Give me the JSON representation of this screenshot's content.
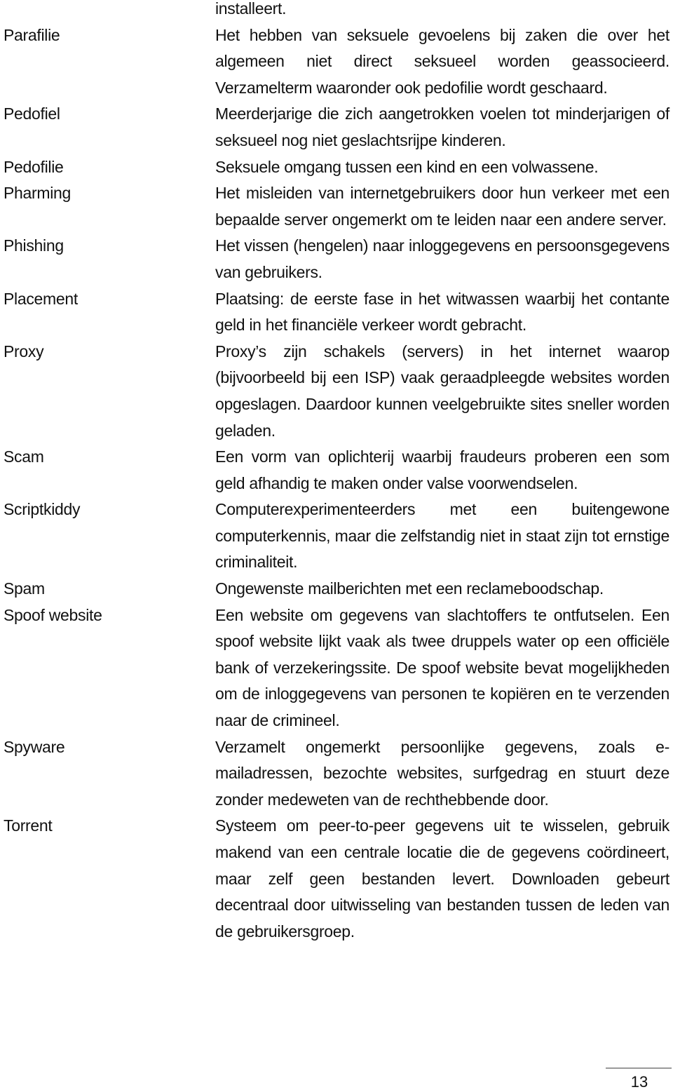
{
  "document": {
    "continuation_text": "installeert.",
    "entries": [
      {
        "term": "Parafilie",
        "definition": "Het hebben van seksuele gevoelens bij zaken die over het algemeen niet direct seksueel worden geassocieerd. Verzamelterm waaronder ook pedofilie wordt geschaard."
      },
      {
        "term": "Pedofiel",
        "definition": "Meerderjarige die zich aangetrokken voelen tot minderjarigen of seksueel nog niet geslachtsrijpe kinderen."
      },
      {
        "term": "Pedofilie",
        "definition": "Seksuele omgang tussen een kind en een volwassene."
      },
      {
        "term": "Pharming",
        "definition": "Het misleiden van internetgebruikers door hun verkeer met een bepaalde server ongemerkt om te leiden naar een andere server."
      },
      {
        "term": "Phishing",
        "definition": "Het vissen (hengelen) naar inloggegevens en persoonsgegevens van gebruikers."
      },
      {
        "term": "Placement",
        "definition": "Plaatsing: de eerste fase in het witwassen waarbij het contante geld in het financiële verkeer wordt gebracht."
      },
      {
        "term": "Proxy",
        "definition": "Proxy’s zijn schakels (servers) in het internet waarop (bijvoorbeeld bij een ISP) vaak geraadpleegde websites worden opgeslagen. Daardoor kunnen veelgebruikte sites sneller worden geladen."
      },
      {
        "term": "Scam",
        "definition": "Een vorm van oplichterij waarbij fraudeurs proberen een som geld afhandig te maken onder valse voorwendselen."
      },
      {
        "term": "Scriptkiddy",
        "definition": "Computerexperimenteerders met een buitengewone computerkennis, maar die zelfstandig niet in staat zijn tot ernstige criminaliteit."
      },
      {
        "term": "Spam",
        "definition": "Ongewenste mailberichten met een reclameboodschap."
      },
      {
        "term": "Spoof website",
        "definition": "Een website om gegevens van slachtoffers te ontfutselen. Een spoof website lijkt vaak als twee druppels water op een officiële bank of verzekeringssite. De spoof website bevat mogelijkheden om de inloggegevens van personen te kopiëren en te verzenden naar de crimineel."
      },
      {
        "term": "Spyware",
        "definition": "Verzamelt ongemerkt persoonlijke gegevens, zoals e-mailadressen, bezochte websites, surfgedrag en stuurt deze zonder medeweten van de rechthebbende door."
      },
      {
        "term": "Torrent",
        "definition": "Systeem om peer-to-peer gegevens uit te wisselen, gebruik makend van een centrale locatie die de gegevens coördineert, maar zelf geen bestanden levert. Downloaden gebeurt decentraal door uitwisseling van bestanden tussen de leden van de gebruikersgroep."
      }
    ]
  },
  "footer": {
    "page_number": "13"
  }
}
